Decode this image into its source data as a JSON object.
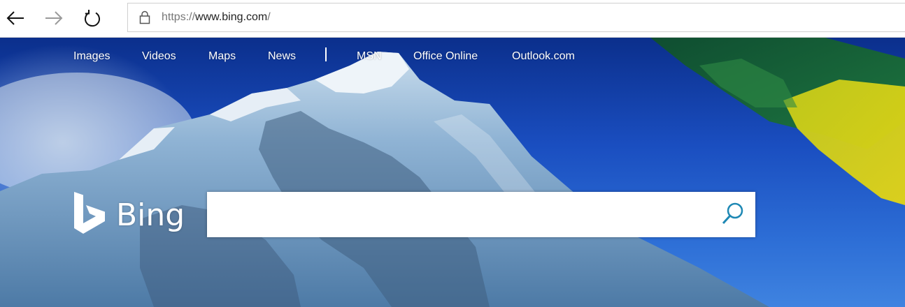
{
  "browser": {
    "url_scheme": "https://",
    "url_host": "www.bing.com",
    "url_path": "/"
  },
  "topnav": {
    "links": [
      "Images",
      "Videos",
      "Maps",
      "News",
      "MSN",
      "Office Online",
      "Outlook.com"
    ]
  },
  "logo": {
    "text": "Bing"
  },
  "search": {
    "value": "",
    "placeholder": ""
  },
  "colors": {
    "accent": "#1e88b4",
    "sky": "#1a4ec0"
  }
}
